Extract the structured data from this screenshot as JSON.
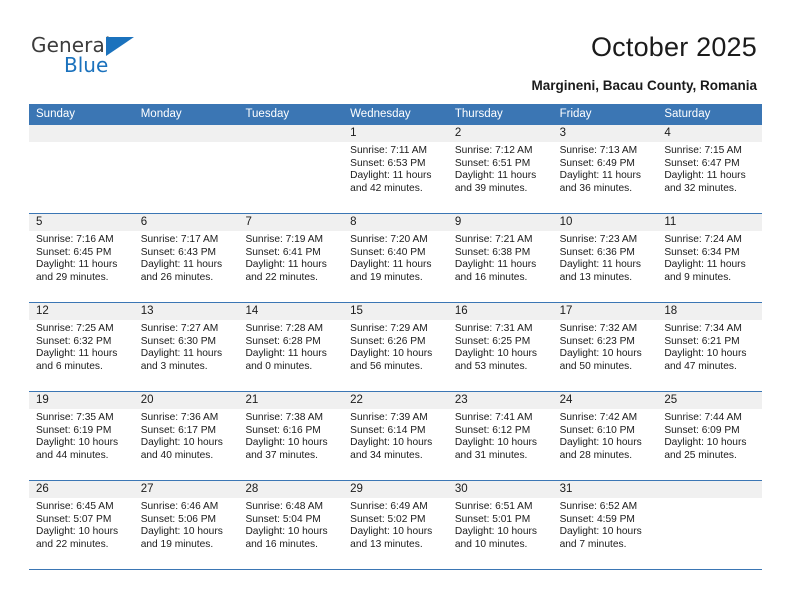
{
  "brand": {
    "name_top": "General",
    "name_bottom": "Blue",
    "accent_color": "#1b72bd"
  },
  "header": {
    "title": "October 2025",
    "subtitle": "Margineni, Bacau County, Romania"
  },
  "calendar": {
    "header_bg": "#3b76b4",
    "daynum_bg": "#f0f0f0",
    "weekday_names": [
      "Sunday",
      "Monday",
      "Tuesday",
      "Wednesday",
      "Thursday",
      "Friday",
      "Saturday"
    ],
    "labels": {
      "sunrise": "Sunrise:",
      "sunset": "Sunset:",
      "daylight": "Daylight:"
    },
    "weeks": [
      [
        {
          "day": ""
        },
        {
          "day": ""
        },
        {
          "day": ""
        },
        {
          "day": "1",
          "sunrise": "Sunrise: 7:11 AM",
          "sunset": "Sunset: 6:53 PM",
          "daylight_1": "Daylight: 11 hours",
          "daylight_2": "and 42 minutes."
        },
        {
          "day": "2",
          "sunrise": "Sunrise: 7:12 AM",
          "sunset": "Sunset: 6:51 PM",
          "daylight_1": "Daylight: 11 hours",
          "daylight_2": "and 39 minutes."
        },
        {
          "day": "3",
          "sunrise": "Sunrise: 7:13 AM",
          "sunset": "Sunset: 6:49 PM",
          "daylight_1": "Daylight: 11 hours",
          "daylight_2": "and 36 minutes."
        },
        {
          "day": "4",
          "sunrise": "Sunrise: 7:15 AM",
          "sunset": "Sunset: 6:47 PM",
          "daylight_1": "Daylight: 11 hours",
          "daylight_2": "and 32 minutes."
        }
      ],
      [
        {
          "day": "5",
          "sunrise": "Sunrise: 7:16 AM",
          "sunset": "Sunset: 6:45 PM",
          "daylight_1": "Daylight: 11 hours",
          "daylight_2": "and 29 minutes."
        },
        {
          "day": "6",
          "sunrise": "Sunrise: 7:17 AM",
          "sunset": "Sunset: 6:43 PM",
          "daylight_1": "Daylight: 11 hours",
          "daylight_2": "and 26 minutes."
        },
        {
          "day": "7",
          "sunrise": "Sunrise: 7:19 AM",
          "sunset": "Sunset: 6:41 PM",
          "daylight_1": "Daylight: 11 hours",
          "daylight_2": "and 22 minutes."
        },
        {
          "day": "8",
          "sunrise": "Sunrise: 7:20 AM",
          "sunset": "Sunset: 6:40 PM",
          "daylight_1": "Daylight: 11 hours",
          "daylight_2": "and 19 minutes."
        },
        {
          "day": "9",
          "sunrise": "Sunrise: 7:21 AM",
          "sunset": "Sunset: 6:38 PM",
          "daylight_1": "Daylight: 11 hours",
          "daylight_2": "and 16 minutes."
        },
        {
          "day": "10",
          "sunrise": "Sunrise: 7:23 AM",
          "sunset": "Sunset: 6:36 PM",
          "daylight_1": "Daylight: 11 hours",
          "daylight_2": "and 13 minutes."
        },
        {
          "day": "11",
          "sunrise": "Sunrise: 7:24 AM",
          "sunset": "Sunset: 6:34 PM",
          "daylight_1": "Daylight: 11 hours",
          "daylight_2": "and 9 minutes."
        }
      ],
      [
        {
          "day": "12",
          "sunrise": "Sunrise: 7:25 AM",
          "sunset": "Sunset: 6:32 PM",
          "daylight_1": "Daylight: 11 hours",
          "daylight_2": "and 6 minutes."
        },
        {
          "day": "13",
          "sunrise": "Sunrise: 7:27 AM",
          "sunset": "Sunset: 6:30 PM",
          "daylight_1": "Daylight: 11 hours",
          "daylight_2": "and 3 minutes."
        },
        {
          "day": "14",
          "sunrise": "Sunrise: 7:28 AM",
          "sunset": "Sunset: 6:28 PM",
          "daylight_1": "Daylight: 11 hours",
          "daylight_2": "and 0 minutes."
        },
        {
          "day": "15",
          "sunrise": "Sunrise: 7:29 AM",
          "sunset": "Sunset: 6:26 PM",
          "daylight_1": "Daylight: 10 hours",
          "daylight_2": "and 56 minutes."
        },
        {
          "day": "16",
          "sunrise": "Sunrise: 7:31 AM",
          "sunset": "Sunset: 6:25 PM",
          "daylight_1": "Daylight: 10 hours",
          "daylight_2": "and 53 minutes."
        },
        {
          "day": "17",
          "sunrise": "Sunrise: 7:32 AM",
          "sunset": "Sunset: 6:23 PM",
          "daylight_1": "Daylight: 10 hours",
          "daylight_2": "and 50 minutes."
        },
        {
          "day": "18",
          "sunrise": "Sunrise: 7:34 AM",
          "sunset": "Sunset: 6:21 PM",
          "daylight_1": "Daylight: 10 hours",
          "daylight_2": "and 47 minutes."
        }
      ],
      [
        {
          "day": "19",
          "sunrise": "Sunrise: 7:35 AM",
          "sunset": "Sunset: 6:19 PM",
          "daylight_1": "Daylight: 10 hours",
          "daylight_2": "and 44 minutes."
        },
        {
          "day": "20",
          "sunrise": "Sunrise: 7:36 AM",
          "sunset": "Sunset: 6:17 PM",
          "daylight_1": "Daylight: 10 hours",
          "daylight_2": "and 40 minutes."
        },
        {
          "day": "21",
          "sunrise": "Sunrise: 7:38 AM",
          "sunset": "Sunset: 6:16 PM",
          "daylight_1": "Daylight: 10 hours",
          "daylight_2": "and 37 minutes."
        },
        {
          "day": "22",
          "sunrise": "Sunrise: 7:39 AM",
          "sunset": "Sunset: 6:14 PM",
          "daylight_1": "Daylight: 10 hours",
          "daylight_2": "and 34 minutes."
        },
        {
          "day": "23",
          "sunrise": "Sunrise: 7:41 AM",
          "sunset": "Sunset: 6:12 PM",
          "daylight_1": "Daylight: 10 hours",
          "daylight_2": "and 31 minutes."
        },
        {
          "day": "24",
          "sunrise": "Sunrise: 7:42 AM",
          "sunset": "Sunset: 6:10 PM",
          "daylight_1": "Daylight: 10 hours",
          "daylight_2": "and 28 minutes."
        },
        {
          "day": "25",
          "sunrise": "Sunrise: 7:44 AM",
          "sunset": "Sunset: 6:09 PM",
          "daylight_1": "Daylight: 10 hours",
          "daylight_2": "and 25 minutes."
        }
      ],
      [
        {
          "day": "26",
          "sunrise": "Sunrise: 6:45 AM",
          "sunset": "Sunset: 5:07 PM",
          "daylight_1": "Daylight: 10 hours",
          "daylight_2": "and 22 minutes."
        },
        {
          "day": "27",
          "sunrise": "Sunrise: 6:46 AM",
          "sunset": "Sunset: 5:06 PM",
          "daylight_1": "Daylight: 10 hours",
          "daylight_2": "and 19 minutes."
        },
        {
          "day": "28",
          "sunrise": "Sunrise: 6:48 AM",
          "sunset": "Sunset: 5:04 PM",
          "daylight_1": "Daylight: 10 hours",
          "daylight_2": "and 16 minutes."
        },
        {
          "day": "29",
          "sunrise": "Sunrise: 6:49 AM",
          "sunset": "Sunset: 5:02 PM",
          "daylight_1": "Daylight: 10 hours",
          "daylight_2": "and 13 minutes."
        },
        {
          "day": "30",
          "sunrise": "Sunrise: 6:51 AM",
          "sunset": "Sunset: 5:01 PM",
          "daylight_1": "Daylight: 10 hours",
          "daylight_2": "and 10 minutes."
        },
        {
          "day": "31",
          "sunrise": "Sunrise: 6:52 AM",
          "sunset": "Sunset: 4:59 PM",
          "daylight_1": "Daylight: 10 hours",
          "daylight_2": "and 7 minutes."
        },
        {
          "day": ""
        }
      ]
    ]
  }
}
